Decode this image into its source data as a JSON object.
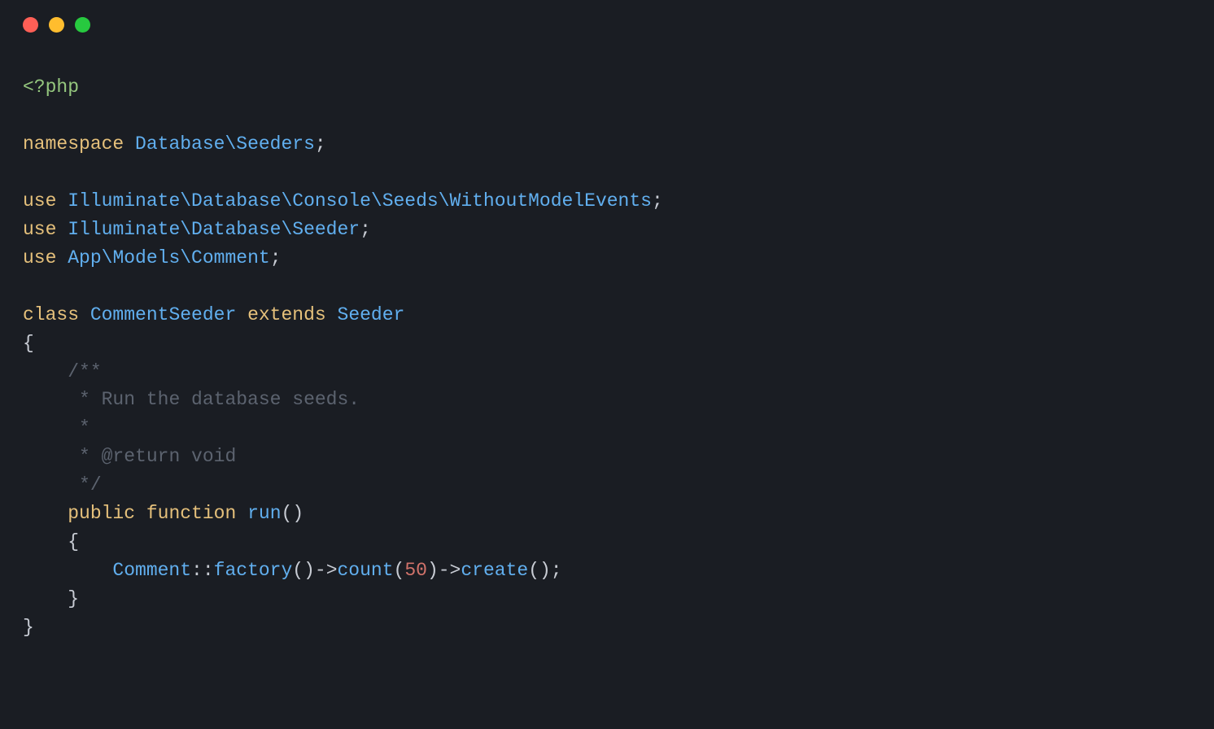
{
  "traffic_lights": {
    "colors": [
      "#ff5f56",
      "#ffbd2e",
      "#27c93f"
    ]
  },
  "code": {
    "open_tag": "<?php",
    "namespace_kw": "namespace",
    "namespace_path": "Database\\Seeders",
    "use_kw": "use",
    "use1": "Illuminate\\Database\\Console\\Seeds\\WithoutModelEvents",
    "use2": "Illuminate\\Database\\Seeder",
    "use3": "App\\Models\\Comment",
    "class_kw": "class",
    "class_name": "CommentSeeder",
    "extends_kw": "extends",
    "extends_name": "Seeder",
    "brace_open": "{",
    "brace_close": "}",
    "comment_l1": "/**",
    "comment_l2": " * Run the database seeds.",
    "comment_l3": " *",
    "comment_l4": " * @return void",
    "comment_l5": " */",
    "public_kw": "public",
    "function_kw": "function",
    "run_fn": "run",
    "parens": "()",
    "comment_class": "Comment",
    "dbl_colon": "::",
    "factory_fn": "factory",
    "arrow": "->",
    "count_fn": "count",
    "paren_open": "(",
    "count_num": "50",
    "paren_close": ")",
    "create_fn": "create",
    "semi": ";"
  }
}
